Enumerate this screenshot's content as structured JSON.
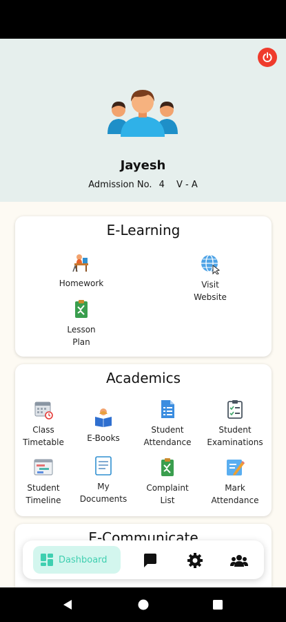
{
  "header": {
    "student_name": "Jayesh",
    "admission_label": "Admission No.",
    "admission_no": "4",
    "class_section": "V - A"
  },
  "elearning": {
    "title": "E-Learning",
    "items": [
      {
        "label": "Homework",
        "icon": "homework-icon"
      },
      {
        "label": "Visit Website",
        "icon": "globe-icon"
      },
      {
        "label": "Lesson Plan",
        "icon": "lesson-plan-icon"
      }
    ]
  },
  "academics": {
    "title": "Academics",
    "items": [
      {
        "label": "Class Timetable",
        "icon": "calendar-icon"
      },
      {
        "label": "E-Books",
        "icon": "e-books-icon"
      },
      {
        "label": "Student Attendance",
        "icon": "attendance-icon"
      },
      {
        "label": "Student Examinations",
        "icon": "examinations-icon"
      },
      {
        "label": "Student Timeline",
        "icon": "timeline-icon"
      },
      {
        "label": "My Documents",
        "icon": "documents-icon"
      },
      {
        "label": "Complaint List",
        "icon": "complaint-icon"
      },
      {
        "label": "Mark Attendance",
        "icon": "mark-attendance-icon"
      }
    ]
  },
  "ecommunicate": {
    "title": "E-Communicate"
  },
  "bottom_nav": {
    "dashboard_label": "Dashboard",
    "accent": "#3fcfb0"
  }
}
